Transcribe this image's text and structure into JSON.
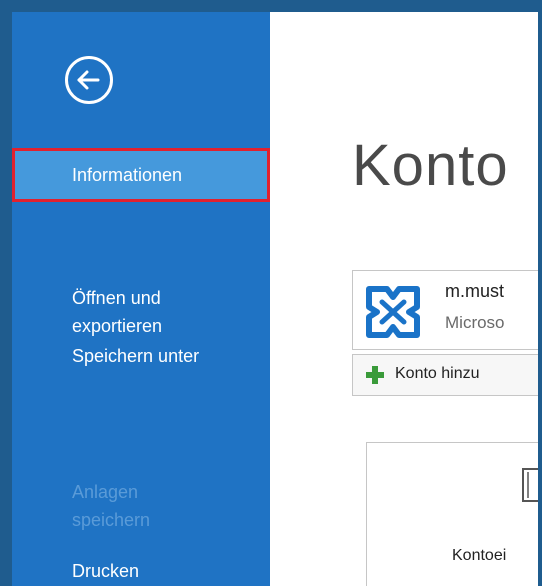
{
  "sidebar": {
    "back_icon": "arrow-left-circle-icon",
    "items": [
      {
        "label": "Informationen",
        "selected": true,
        "disabled": false
      },
      {
        "label": "Öffnen und\nexportieren",
        "selected": false,
        "disabled": false
      },
      {
        "label": "Speichern unter",
        "selected": false,
        "disabled": false
      },
      {
        "label": "Anlagen\nspeichern",
        "selected": false,
        "disabled": true
      },
      {
        "label": "Drucken",
        "selected": false,
        "disabled": false
      }
    ]
  },
  "main": {
    "title": "Konto",
    "account": {
      "email": "m.must",
      "type": "Microso",
      "icon": "exchange-icon"
    },
    "add_account": {
      "label": "Konto hinzu",
      "icon": "plus-icon"
    },
    "settings_tile": {
      "label": "Kontoei",
      "icon": "document-icon"
    }
  },
  "colors": {
    "sidebar_bg": "#1f73c4",
    "selected_bg": "#4599dc",
    "selection_border": "#e1212e",
    "frame": "#1f5c8e",
    "plus_green": "#3a9b3a",
    "exchange_blue": "#1a73c8"
  }
}
